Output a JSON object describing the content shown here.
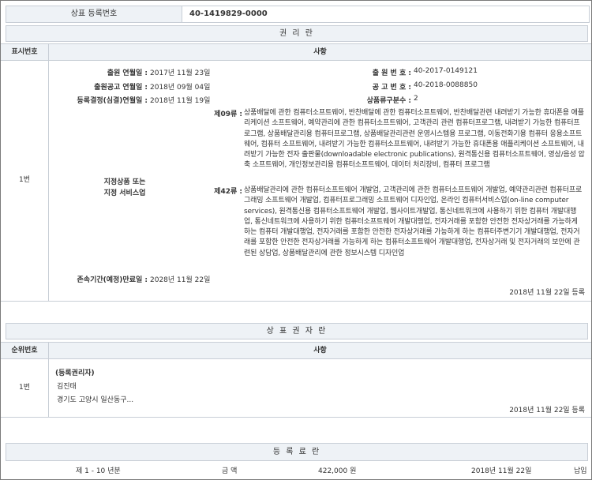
{
  "header": {
    "reg_label": "상표 등록번호",
    "reg_number": "40-1419829-0000"
  },
  "rights": {
    "section_title": "권 리 란",
    "col_no": "표시번호",
    "col_desc": "사항",
    "row_no": "1번",
    "app_date_label": "출원 연월일 :",
    "app_date": "2017년 11월 23일",
    "app_no_label": "출 원 번 호 :",
    "app_no": "40-2017-0149121",
    "pub_date_label": "출원공고 연월일 :",
    "pub_date": "2018년 09월 04일",
    "pub_no_label": "공 고 번 호 :",
    "pub_no": "40-2018-0088850",
    "decision_label": "등록결정(심결)연월일 :",
    "decision_date": "2018년 11월 19일",
    "class_count_label": "상품류구분수 :",
    "class_count": "2",
    "goods_label_1": "지정상품 또는",
    "goods_label_2": "지정 서비스업",
    "class09_label": "제09류 :",
    "class09_text": "상품배달에 관한 컴퓨터소프트웨어, 반찬배달에 관한 컴퓨터소프트웨어, 반찬배달관련 내려받기 가능한 휴대폰용 애플리케이션 소프트웨어, 예약관리에 관한 컴퓨터소프트웨어, 고객관리 관련 컴퓨터프로그램, 내려받기 가능한 컴퓨터프로그램, 상품배달관리용 컴퓨터프로그램, 상품배달관리관련 운영시스템용 프로그램, 이동전화기용 컴퓨터 응용소프트웨어, 컴퓨터 소프트웨어, 내려받기 가능한 컴퓨터소프트웨어, 내려받기 가능한 휴대폰용 애플리케이션 소프트웨어, 내려받기 가능한 전자 출판물(downloadable electronic publications), 원격통신용 컴퓨터소프트웨어, 영상/음성 압축 소프트웨어, 개인정보관리용 컴퓨터소프트웨어, 데이터 처리장비, 컴퓨터 프로그램",
    "class42_label": "제42류 :",
    "class42_text": "상품배달관리에 관한 컴퓨터소프트웨어 개발업, 고객관리에 관한 컴퓨터소프트웨어 개발업, 예약관리관련 컴퓨터프로그래밍 소프트웨어 개발업, 컴퓨터프로그래밍 소프트웨어 디자인업, 온라인 컴퓨터서비스업(on-line computer services), 원격통신용 컴퓨터소프트웨어 개발업, 웹사이트개발업, 통신네트워크에 사용하기 위한 컴퓨터 개발대행업, 통신네트워크에 사용하기 위한 컴퓨터소프트웨어 개발대행업, 전자거래를 포함한 안전한 전자상거래를 가능하게 하는 컴퓨터 개발대행업, 전자거래를 포함한 안전한 전자상거래를 가능하게 하는 컴퓨터주변기기 개발대행업, 전자거래를 포함한 안전한 전자상거래를 가능하게 하는 컴퓨터소프트웨어 개발대행업, 전자상거래 및 전자거래의 보안에 관련된 상담업, 상품배달관리에 관한 정보시스템 디자인업",
    "expiry_label": "존속기간(예정)만료일 :",
    "expiry_date": "2028년 11월 22일",
    "reg_note": "2018년 11월 22일 등록"
  },
  "owner": {
    "section_title": "상 표 권 자 란",
    "col_no": "순위번호",
    "col_desc": "사항",
    "row_no": "1번",
    "role": "(등록권리자)",
    "name": "김진태",
    "address": "경기도 고양시 일산동구...",
    "reg_note": "2018년 11월 22일 등록"
  },
  "fee": {
    "section_title": "등 록 료 란",
    "period": "제 1 - 10 년분",
    "amount_label": "금 액",
    "amount": "422,000 원",
    "date": "2018년 11월 22일",
    "status": "납입"
  }
}
